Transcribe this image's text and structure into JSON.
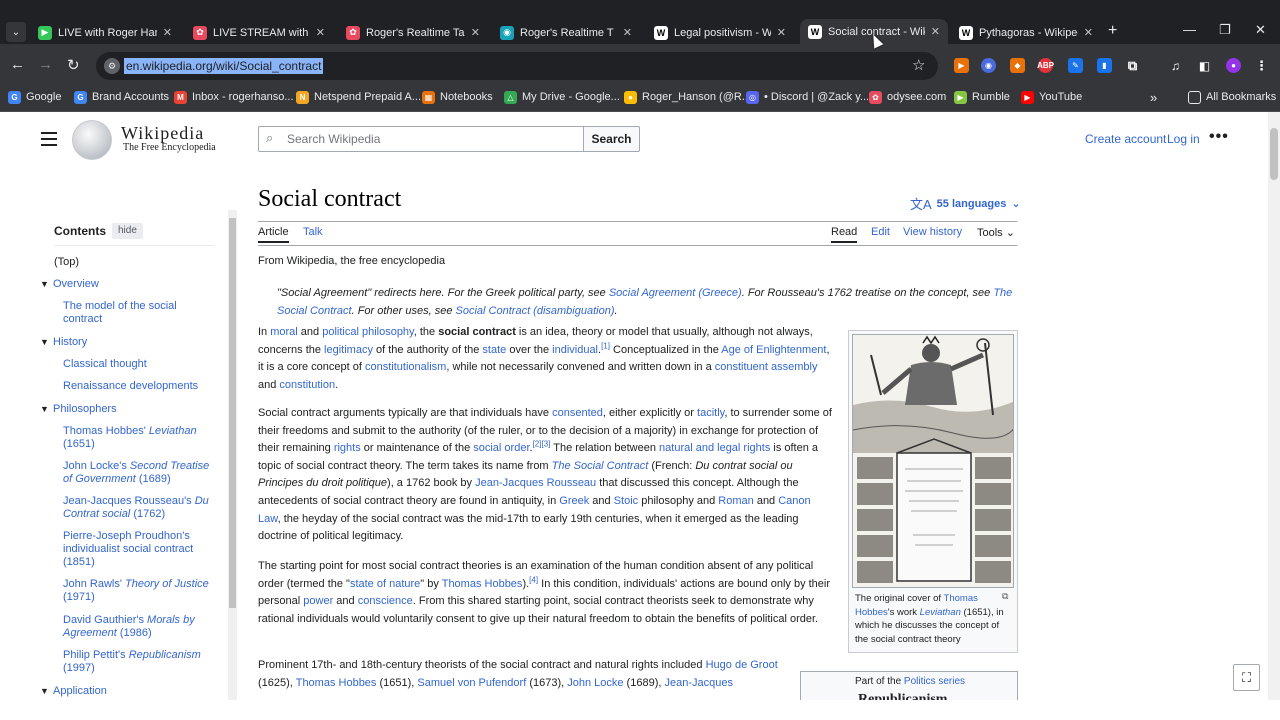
{
  "browser": {
    "tabs": [
      {
        "title": "LIVE with Roger Hanso",
        "icon_color": "#35c759",
        "icon_glyph": "▶"
      },
      {
        "title": "LIVE STREAM with Rog",
        "icon_color": "#e84a5f",
        "icon_glyph": "✿"
      },
      {
        "title": "Roger's Realtime Talks",
        "icon_color": "#e84a5f",
        "icon_glyph": "✿"
      },
      {
        "title": "Roger's Realtime T",
        "icon_color": "#17a2b8",
        "icon_glyph": "◉"
      },
      {
        "title": "Legal positivism - Wiki",
        "icon_color": "#ffffff",
        "icon_glyph": "W"
      },
      {
        "title": "Social contract - Wikip",
        "icon_color": "#ffffff",
        "icon_glyph": "W",
        "active": true
      },
      {
        "title": "Pythagoras - Wikipedia",
        "icon_color": "#ffffff",
        "icon_glyph": "W"
      }
    ],
    "url": "en.wikipedia.org/wiki/Social_contract",
    "bookmarks": [
      {
        "label": "Google",
        "color": "#4285f4",
        "glyph": "G"
      },
      {
        "label": "Brand Accounts",
        "color": "#4285f4",
        "glyph": "G"
      },
      {
        "label": "Inbox - rogerhanso...",
        "color": "#ea4335",
        "glyph": "M"
      },
      {
        "label": "Netspend Prepaid A...",
        "color": "#f5a623",
        "glyph": "N"
      },
      {
        "label": "Notebooks",
        "color": "#e8710a",
        "glyph": "▦"
      },
      {
        "label": "My Drive - Google...",
        "color": "#34a853",
        "glyph": "△"
      },
      {
        "label": "Roger_Hanson (@R...",
        "color": "#fbbc04",
        "glyph": "●"
      },
      {
        "label": "• Discord | @Zack y...",
        "color": "#5865f2",
        "glyph": "◎"
      },
      {
        "label": "odysee.com",
        "color": "#e84a5f",
        "glyph": "✿"
      },
      {
        "label": "Rumble",
        "color": "#85c742",
        "glyph": "▶"
      },
      {
        "label": "YouTube",
        "color": "#ff0000",
        "glyph": "▶"
      }
    ],
    "all_bookmarks": "All Bookmarks"
  },
  "wiki": {
    "wordmark": "Wikipedia",
    "tagline": "The Free Encyclopedia",
    "search_placeholder": "Search Wikipedia",
    "search_button": "Search",
    "create_account": "Create account",
    "log_in": "Log in"
  },
  "toc": {
    "title": "Contents",
    "hide": "hide",
    "top": "(Top)",
    "sections": [
      {
        "label": "Overview",
        "children": [
          "The model of the social contract"
        ]
      },
      {
        "label": "History",
        "children": [
          "Classical thought",
          "Renaissance developments"
        ]
      },
      {
        "label": "Philosophers",
        "children": [
          {
            "plain": "Thomas Hobbes' ",
            "italic": "Leviathan",
            "year": "(1651)"
          },
          {
            "plain": "John Locke's ",
            "italic": "Second Treatise of Government",
            "year": "(1689)"
          },
          {
            "plain": "Jean-Jacques Rousseau's ",
            "italic": "Du Contrat social",
            "year": "(1762)"
          },
          {
            "plain": "Pierre-Joseph Proudhon's individualist social contract",
            "italic": "",
            "year": "(1851)"
          },
          {
            "plain": "John Rawls' ",
            "italic": "Theory of Justice",
            "year": "(1971)"
          },
          {
            "plain": "David Gauthier's ",
            "italic": "Morals by Agreement",
            "year": "(1986)"
          },
          {
            "plain": "Philip Pettit's ",
            "italic": "Republicanism",
            "year": "(1997)"
          }
        ]
      },
      {
        "label": "Application",
        "children": []
      }
    ]
  },
  "article": {
    "title": "Social contract",
    "languages": "55 languages",
    "tabs": {
      "article": "Article",
      "talk": "Talk",
      "read": "Read",
      "edit": "Edit",
      "history": "View history",
      "tools": "Tools"
    },
    "from": "From Wikipedia, the free encyclopedia",
    "caption": {
      "pre": "The original cover of ",
      "link1": "Thomas Hobbes",
      "mid": "'s work ",
      "link2": "Leviathan",
      "post": " (1651), in which he discusses the concept of the social contract theory"
    },
    "series_pre": "Part of the ",
    "series_link": "Politics series",
    "series_next": "Republicanism"
  }
}
